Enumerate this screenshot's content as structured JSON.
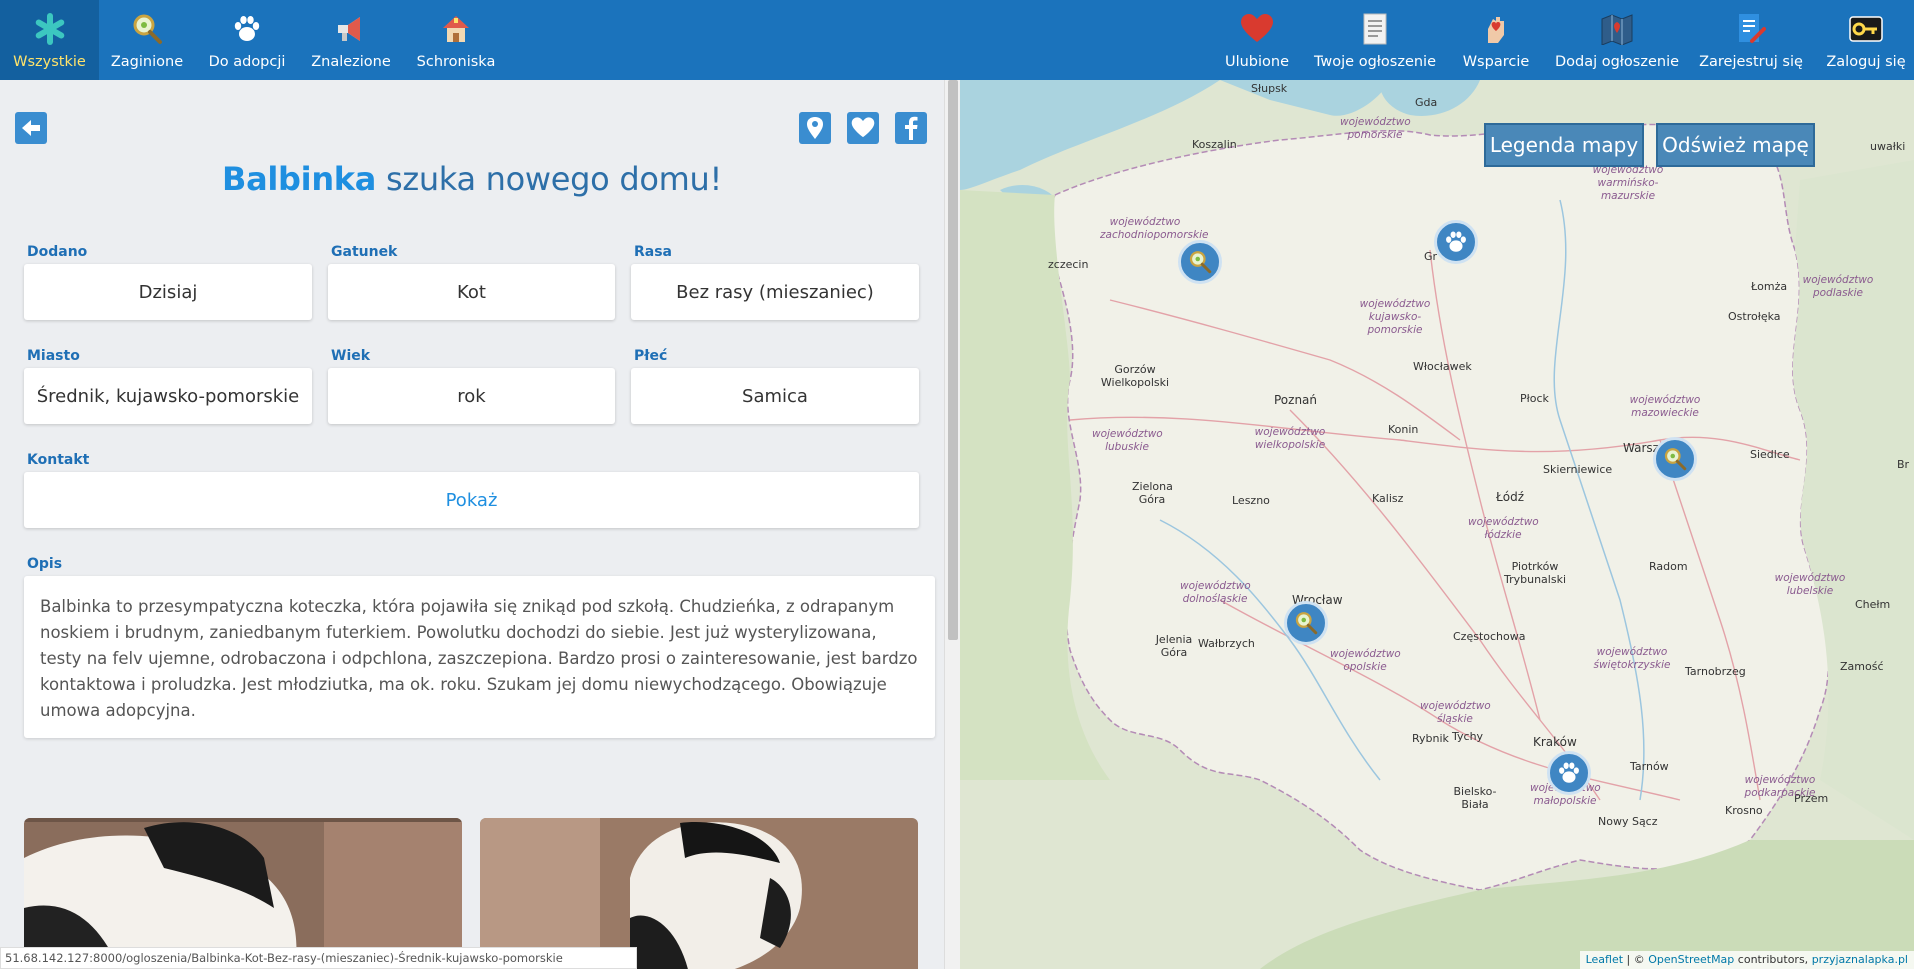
{
  "nav_left": [
    {
      "label": "Wszystkie",
      "icon": "asterisk-icon",
      "active": true
    },
    {
      "label": "Zaginione",
      "icon": "magnifier-icon"
    },
    {
      "label": "Do adopcji",
      "icon": "paw-icon"
    },
    {
      "label": "Znalezione",
      "icon": "megaphone-icon"
    },
    {
      "label": "Schroniska",
      "icon": "house-icon"
    }
  ],
  "nav_right": [
    {
      "label": "Ulubione",
      "icon": "heart-icon"
    },
    {
      "label": "Twoje ogłoszenie",
      "icon": "document-icon"
    },
    {
      "label": "Wsparcie",
      "icon": "hand-heart-icon"
    },
    {
      "label": "Dodaj ogłoszenie",
      "icon": "map-pin-icon"
    },
    {
      "label": "Zarejestruj się",
      "icon": "register-icon"
    },
    {
      "label": "Zaloguj się",
      "icon": "key-icon"
    }
  ],
  "heading": {
    "name": "Balbinka",
    "rest": " szuka nowego domu!"
  },
  "fields": {
    "dodano": {
      "label": "Dodano",
      "value": "Dzisiaj"
    },
    "gatunek": {
      "label": "Gatunek",
      "value": "Kot"
    },
    "rasa": {
      "label": "Rasa",
      "value": "Bez rasy (mieszaniec)"
    },
    "miasto": {
      "label": "Miasto",
      "value": "Średnik, kujawsko-pomorskie"
    },
    "wiek": {
      "label": "Wiek",
      "value": "rok"
    },
    "plec": {
      "label": "Płeć",
      "value": "Samica"
    },
    "kontakt": {
      "label": "Kontakt",
      "value": "Pokaż"
    },
    "opis": {
      "label": "Opis",
      "value": "Balbinka to przesympatyczna koteczka, która pojawiła się znikąd pod szkołą. Chudzieńka, z odrapanym noskiem i brudnym, zaniedbanym futerkiem. Powolutku dochodzi do siebie. Jest już wysterylizowana, testy na felv ujemne, odrobaczona i odpchlona, zaszczepiona. Bardzo prosi o zainteresowanie, jest bardzo kontaktowa i proludzka. Jest młodziutka, ma ok. roku. Szukam jej domu niewychodzącego. Obowiązuje umowa adopcyjna."
    }
  },
  "status_url": "51.68.142.127:8000/ogloszenia/Balbinka-Kot-Bez-rasy-(mieszaniec)-Średnik-kujawsko-pomorskie",
  "map": {
    "legend_btn": "Legenda mapy",
    "refresh_btn": "Odśwież mapę",
    "attribution": {
      "leaflet": "Leaflet",
      "sep": " | © ",
      "osm": "OpenStreetMap",
      "contrib": " contributors, ",
      "site": "przyjaznalapka.pl"
    },
    "cities": [
      "Słupsk",
      "Gda",
      "Koszalin",
      "zczecin",
      "Gr",
      "Łomża",
      "Ostrołęka",
      "Gorzów Wielkopolski",
      "Włocławek",
      "Płock",
      "Poznań",
      "Konin",
      "Warsz",
      "Siedlce",
      "Skierniewice",
      "Zielona Góra",
      "Leszno",
      "Kalisz",
      "Łódź",
      "Piotrków Trybunalski",
      "Radom",
      "Wrocław",
      "Jelenia Góra",
      "Wałbrzych",
      "Częstochowa",
      "Tarnobrzeg",
      "Chełm",
      "Zamość",
      "Rybnik",
      "Tychy",
      "Kraków",
      "Tarnów",
      "Bielsko-Biała",
      "Nowy Sącz",
      "Krosno",
      "Przem",
      "uwałki",
      "Br"
    ],
    "regions": [
      "województwo pomorskie",
      "województwo warmińsko-mazurskie",
      "województwo zachodniopomorskie",
      "województwo podlaskie",
      "województwo kujawsko-pomorskie",
      "województwo mazowieckie",
      "województwo lubuskie",
      "województwo wielkopolskie",
      "województwo łódzkie",
      "województwo lubelskie",
      "województwo dolnośląskie",
      "województwo opolskie",
      "województwo świętokrzyskie",
      "województwo śląskie",
      "województwo małopolskie",
      "województwo podkarpackie"
    ]
  },
  "colors": {
    "topbar": "#1b73bc",
    "active_label": "#ffe36b",
    "accent": "#1f8fe0",
    "marker": "#3f86c3"
  }
}
